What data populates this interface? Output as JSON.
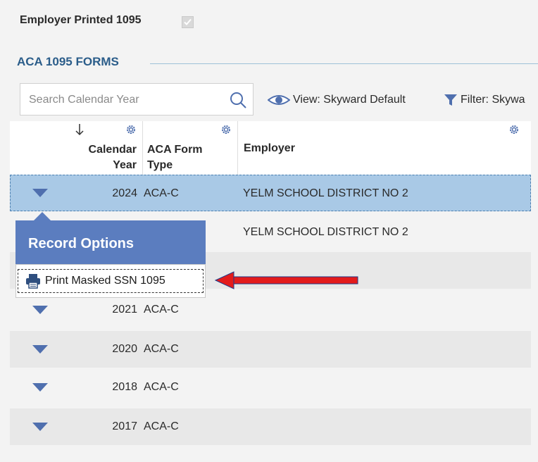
{
  "employer_printed": {
    "label": "Employer Printed 1095",
    "checked": true
  },
  "section": {
    "title": "ACA 1095 FORMS"
  },
  "toolbar": {
    "search_placeholder": "Search Calendar Year",
    "view_label": "View: Skyward Default",
    "filter_label": "Filter: Skywa"
  },
  "table": {
    "columns": [
      {
        "label_line1": "Calendar",
        "label_line2": "Year"
      },
      {
        "label_line1": "ACA Form",
        "label_line2": "Type"
      },
      {
        "label_line1": "Employer",
        "label_line2": ""
      }
    ],
    "rows": [
      {
        "year": "2024",
        "type": "ACA-C",
        "employer": "YELM SCHOOL DISTRICT NO 2",
        "selected": true
      },
      {
        "year": "",
        "type": "",
        "employer": "YELM SCHOOL DISTRICT NO 2",
        "selected": false
      },
      {
        "year": "",
        "type": "",
        "employer": "",
        "selected": false
      },
      {
        "year": "2021",
        "type": "ACA-C",
        "employer": "",
        "selected": false
      },
      {
        "year": "2020",
        "type": "ACA-C",
        "employer": "",
        "selected": false
      },
      {
        "year": "2018",
        "type": "ACA-C",
        "employer": "",
        "selected": false
      },
      {
        "year": "2017",
        "type": "ACA-C",
        "employer": "",
        "selected": false
      }
    ]
  },
  "record_options": {
    "title": "Record Options",
    "items": [
      {
        "label": "Print Masked SSN 1095",
        "icon": "printer-icon"
      }
    ]
  },
  "annotation": {
    "arrow_color": "#e31b1b",
    "icon": "red-arrow"
  },
  "colors": {
    "accent_blue": "#5b7dbf",
    "selected_row": "#a9c9e6",
    "section_title": "#2b5d8a",
    "triangle": "#4f6fae"
  }
}
